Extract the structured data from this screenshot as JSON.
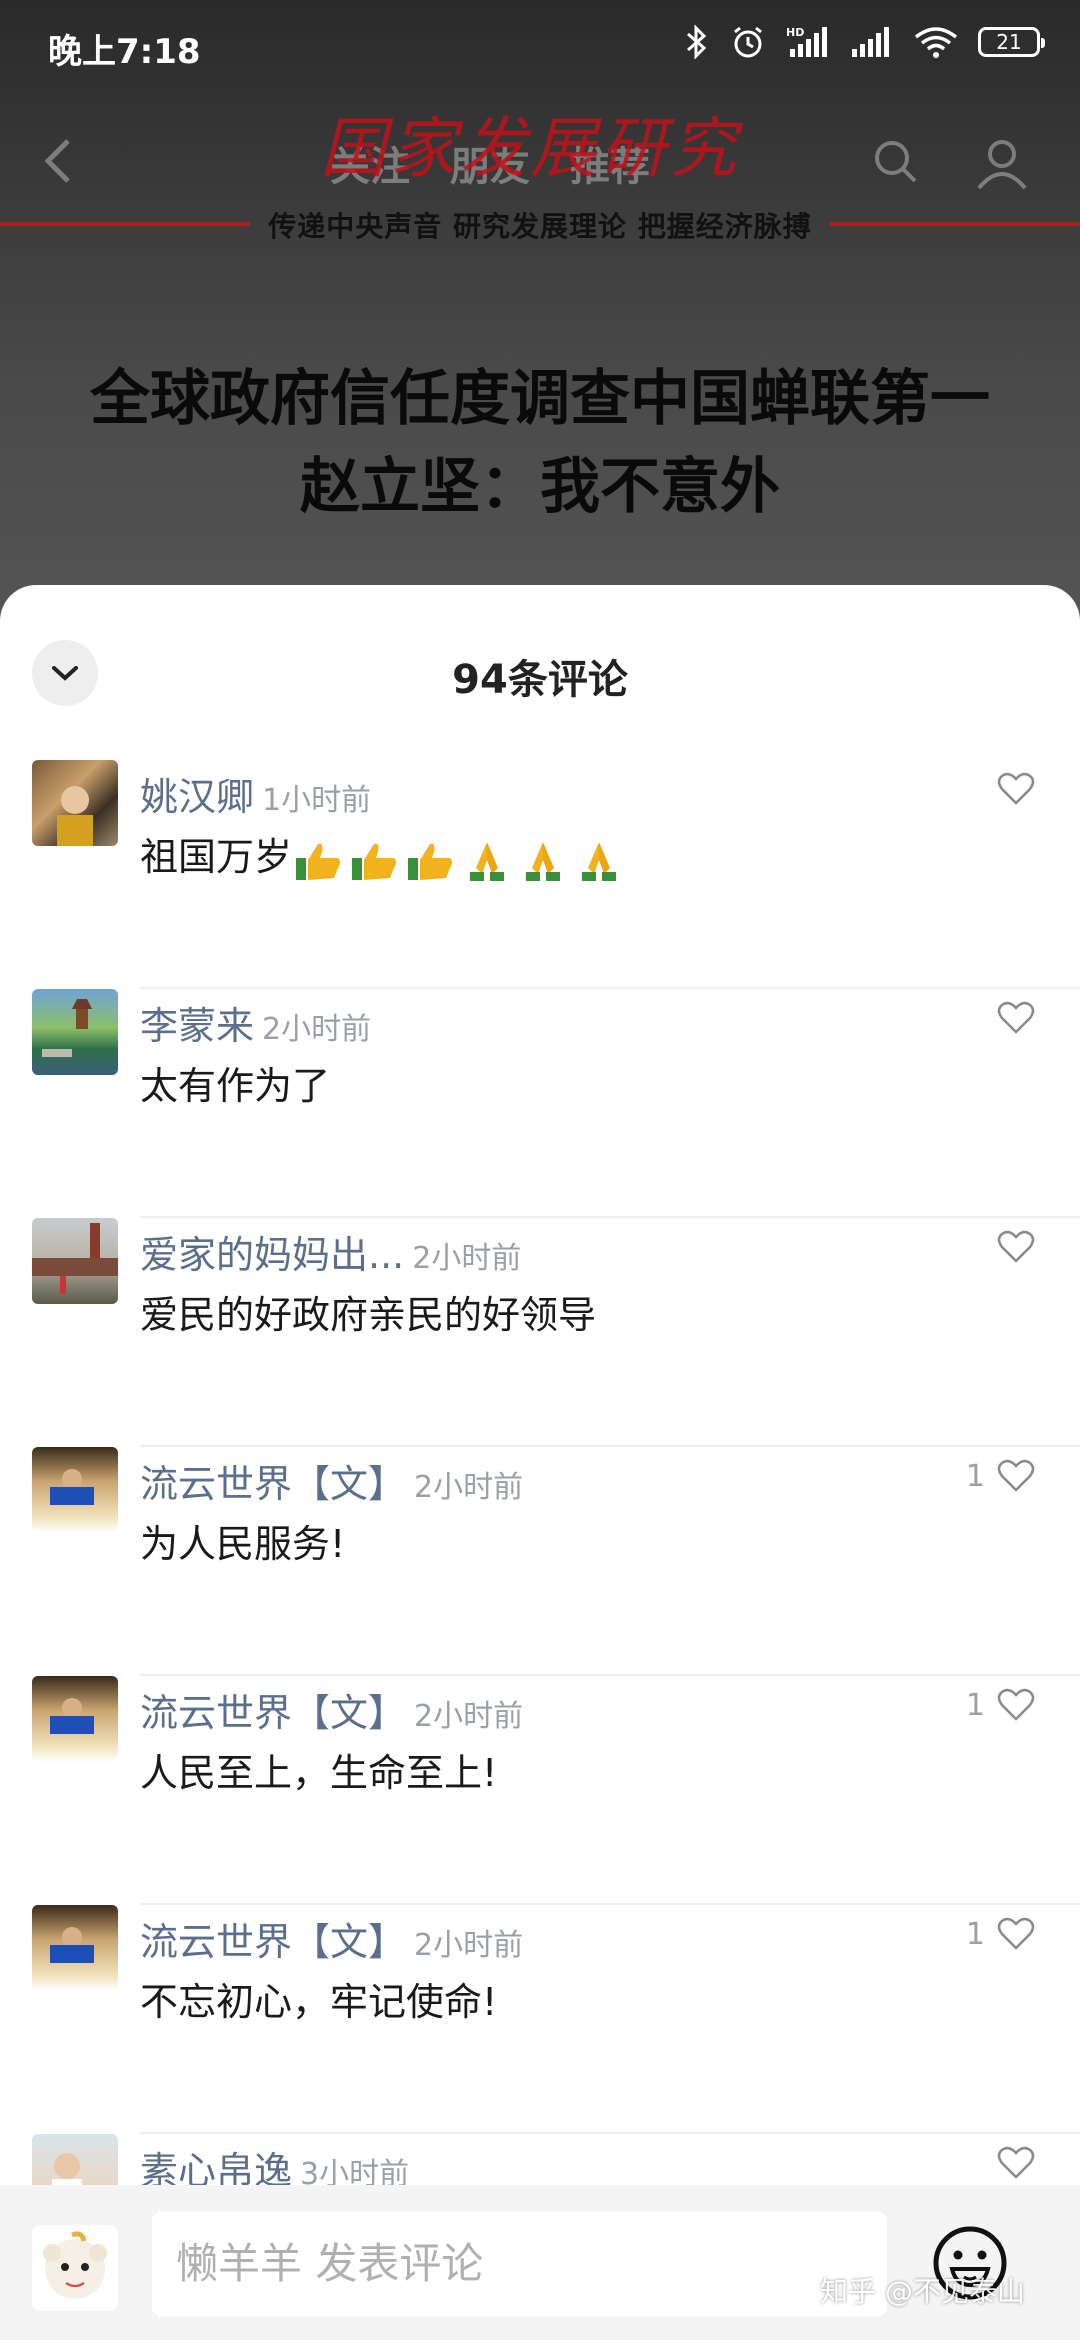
{
  "status_bar": {
    "time": "晚上7:18",
    "battery": "21"
  },
  "background": {
    "nav_tabs": [
      "关注",
      "朋友",
      "推荐"
    ],
    "brand": "国家发展研究",
    "slogan": "传递中央声音  研究发展理论  把握经济脉搏",
    "headline_line1": "全球政府信任度调查中国蝉联第一",
    "headline_line2": "赵立坚：我不意外"
  },
  "sheet": {
    "title": "94条评论",
    "comments": [
      {
        "name": "姚汉卿",
        "time": "1小时前",
        "text": "祖国万岁",
        "emojis": [
          "thumbs-up",
          "thumbs-up",
          "thumbs-up",
          "praying-hands",
          "praying-hands",
          "praying-hands"
        ],
        "likes": ""
      },
      {
        "name": "李蒙来",
        "time": "2小时前",
        "text": "太有作为了",
        "likes": ""
      },
      {
        "name": "爱家的妈妈出...",
        "time": "2小时前",
        "text": "爱民的好政府亲民的好领导",
        "likes": ""
      },
      {
        "name": "流云世界【文】",
        "time": "2小时前",
        "text": "为人民服务!",
        "likes": "1"
      },
      {
        "name": "流云世界【文】",
        "time": "2小时前",
        "text": "人民至上，生命至上!",
        "likes": "1"
      },
      {
        "name": "流云世界【文】",
        "time": "2小时前",
        "text": "不忘初心，牢记使命!",
        "likes": "1"
      },
      {
        "name": "素心帛逸",
        "time": "3小时前",
        "text": "",
        "likes": ""
      }
    ]
  },
  "input_bar": {
    "placeholder": "懒羊羊 发表评论"
  },
  "watermark": "知乎 @不见泰山"
}
